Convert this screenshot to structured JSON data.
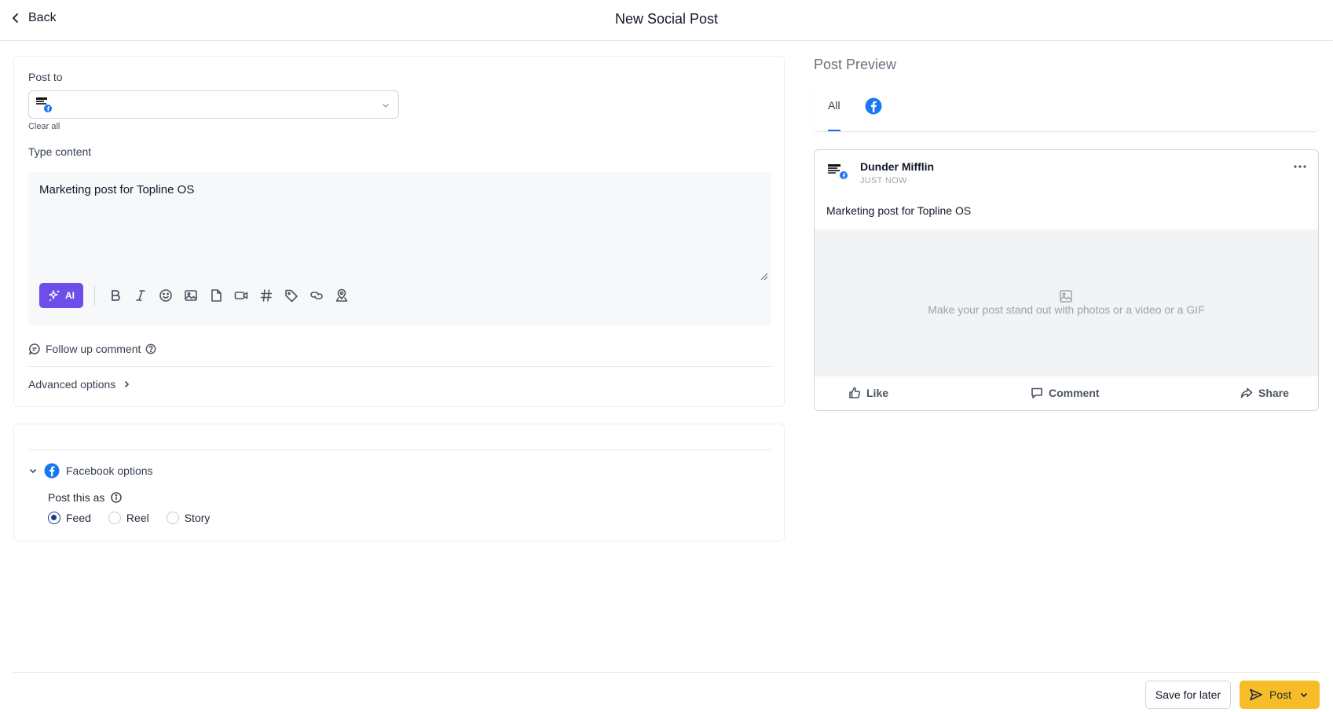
{
  "header": {
    "back_label": "Back",
    "title": "New Social Post"
  },
  "form": {
    "post_to_label": "Post to",
    "clear_all_label": "Clear all",
    "type_content_label": "Type content",
    "content_text": "Marketing post for Topline OS",
    "ai_label": "AI",
    "toolbar_icons": [
      "bold-icon",
      "italic-icon",
      "emoji-icon",
      "image-icon",
      "file-icon",
      "video-icon",
      "hashtag-icon",
      "tag-icon",
      "link-icon",
      "location-icon"
    ],
    "follow_up_label": "Follow up comment",
    "advanced_label": "Advanced options"
  },
  "facebook_options": {
    "title": "Facebook options",
    "post_as_label": "Post this as",
    "options": [
      {
        "label": "Feed",
        "selected": true
      },
      {
        "label": "Reel",
        "selected": false
      },
      {
        "label": "Story",
        "selected": false
      }
    ]
  },
  "preview": {
    "title": "Post Preview",
    "tab_all": "All",
    "account_name": "Dunder Mifflin",
    "time": "JUST NOW",
    "text": "Marketing post for Topline OS",
    "media_placeholder": "Make your post stand out with photos or a video or a GIF",
    "actions": {
      "like": "Like",
      "comment": "Comment",
      "share": "Share"
    }
  },
  "footer": {
    "save_label": "Save for later",
    "post_label": "Post"
  },
  "colors": {
    "accent_ai": "#6d4ee8",
    "post_button": "#f6bd28",
    "facebook_blue": "#1877f2",
    "tab_underline": "#2563eb"
  }
}
